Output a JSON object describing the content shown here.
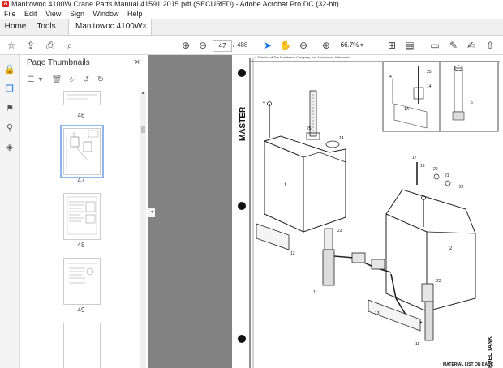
{
  "window": {
    "title": "Manitowoc 4100W Crane Parts Manual 41591 2015.pdf (SECURED) - Adobe Acrobat Pro DC (32-bit)"
  },
  "menu": [
    "File",
    "Edit",
    "View",
    "Sign",
    "Window",
    "Help"
  ],
  "tabs": {
    "home": "Home",
    "tools": "Tools",
    "document": "Manitowoc 4100W...",
    "close": "×"
  },
  "toolbar": {
    "current_page": "47",
    "separator": "/",
    "total_pages": "488",
    "zoom": "66.7%",
    "zoom_dropdown": "▾"
  },
  "panel": {
    "title": "Page Thumbnails",
    "close": "×",
    "thumbnails": [
      {
        "label": "46"
      },
      {
        "label": "47",
        "selected": true
      },
      {
        "label": "48"
      },
      {
        "label": "49"
      }
    ]
  },
  "drawing": {
    "header_line": "A Division of The Manitowoc Company, Inc.      Manitowoc, Wisconsin",
    "side_master": "MASTER",
    "side_fuel": "FUEL TANK",
    "footer": "MATERIAL LIST ON BACK",
    "callouts": [
      "4",
      "25",
      "14",
      "1",
      "23",
      "12",
      "11",
      "17",
      "19",
      "20",
      "21",
      "22",
      "2",
      "23",
      "13",
      "11",
      "1A",
      "5",
      "4"
    ]
  }
}
